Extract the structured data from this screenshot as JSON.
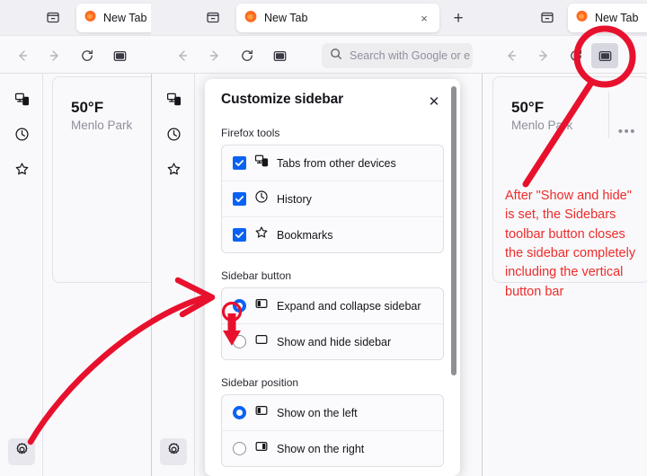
{
  "windows": {
    "left": {
      "tab_title": "New Tab"
    },
    "center": {
      "tab_title": "New Tab",
      "urlbar_placeholder": "Search with Google or e"
    },
    "right": {
      "tab_title": "New Tab"
    }
  },
  "toolbar": {
    "list_all_tabs": "list-all-tabs",
    "new_tab": "+",
    "back": "Back",
    "forward": "Forward",
    "reload": "Reload",
    "sidebars": "Sidebars",
    "close_tab": "×"
  },
  "sidebar_bar": {
    "items": [
      {
        "name": "tabs-from-other-devices",
        "label": "Tabs from other devices"
      },
      {
        "name": "history",
        "label": "History"
      },
      {
        "name": "bookmarks",
        "label": "Bookmarks"
      }
    ],
    "settings_label": "Customize sidebar"
  },
  "weather": {
    "temperature": "50°F",
    "city": "Menlo Park",
    "menu": "•••"
  },
  "panel": {
    "title": "Customize sidebar",
    "close": "✕",
    "groups": [
      {
        "label": "Firefox tools",
        "type": "checkbox",
        "options": [
          {
            "label": "Tabs from other devices",
            "checked": true,
            "icon": "device-tabs-icon"
          },
          {
            "label": "History",
            "checked": true,
            "icon": "clock-icon"
          },
          {
            "label": "Bookmarks",
            "checked": true,
            "icon": "star-icon"
          }
        ]
      },
      {
        "label": "Sidebar button",
        "type": "radio",
        "options": [
          {
            "label": "Expand and collapse sidebar",
            "selected": true,
            "icon": "sidebar-expand-icon"
          },
          {
            "label": "Show and hide sidebar",
            "selected": false,
            "icon": "sidebar-hide-icon"
          }
        ]
      },
      {
        "label": "Sidebar position",
        "type": "radio",
        "options": [
          {
            "label": "Show on the left",
            "selected": true,
            "icon": "sidebar-left-icon"
          },
          {
            "label": "Show on the right",
            "selected": false,
            "icon": "sidebar-right-icon"
          }
        ]
      }
    ]
  },
  "annotation": {
    "text": "After \"Show and hide\" is set, the Sidebars toolbar button closes the sidebar completely including the vertical button bar",
    "color": "#ee2b2b"
  },
  "colors": {
    "accent_blue": "#0a62f5",
    "annotation_red": "#ee2b2b",
    "chrome_bg": "#f9f9fb",
    "tabstrip_bg": "#f0f0f4",
    "panel_bg": "#ffffff"
  }
}
